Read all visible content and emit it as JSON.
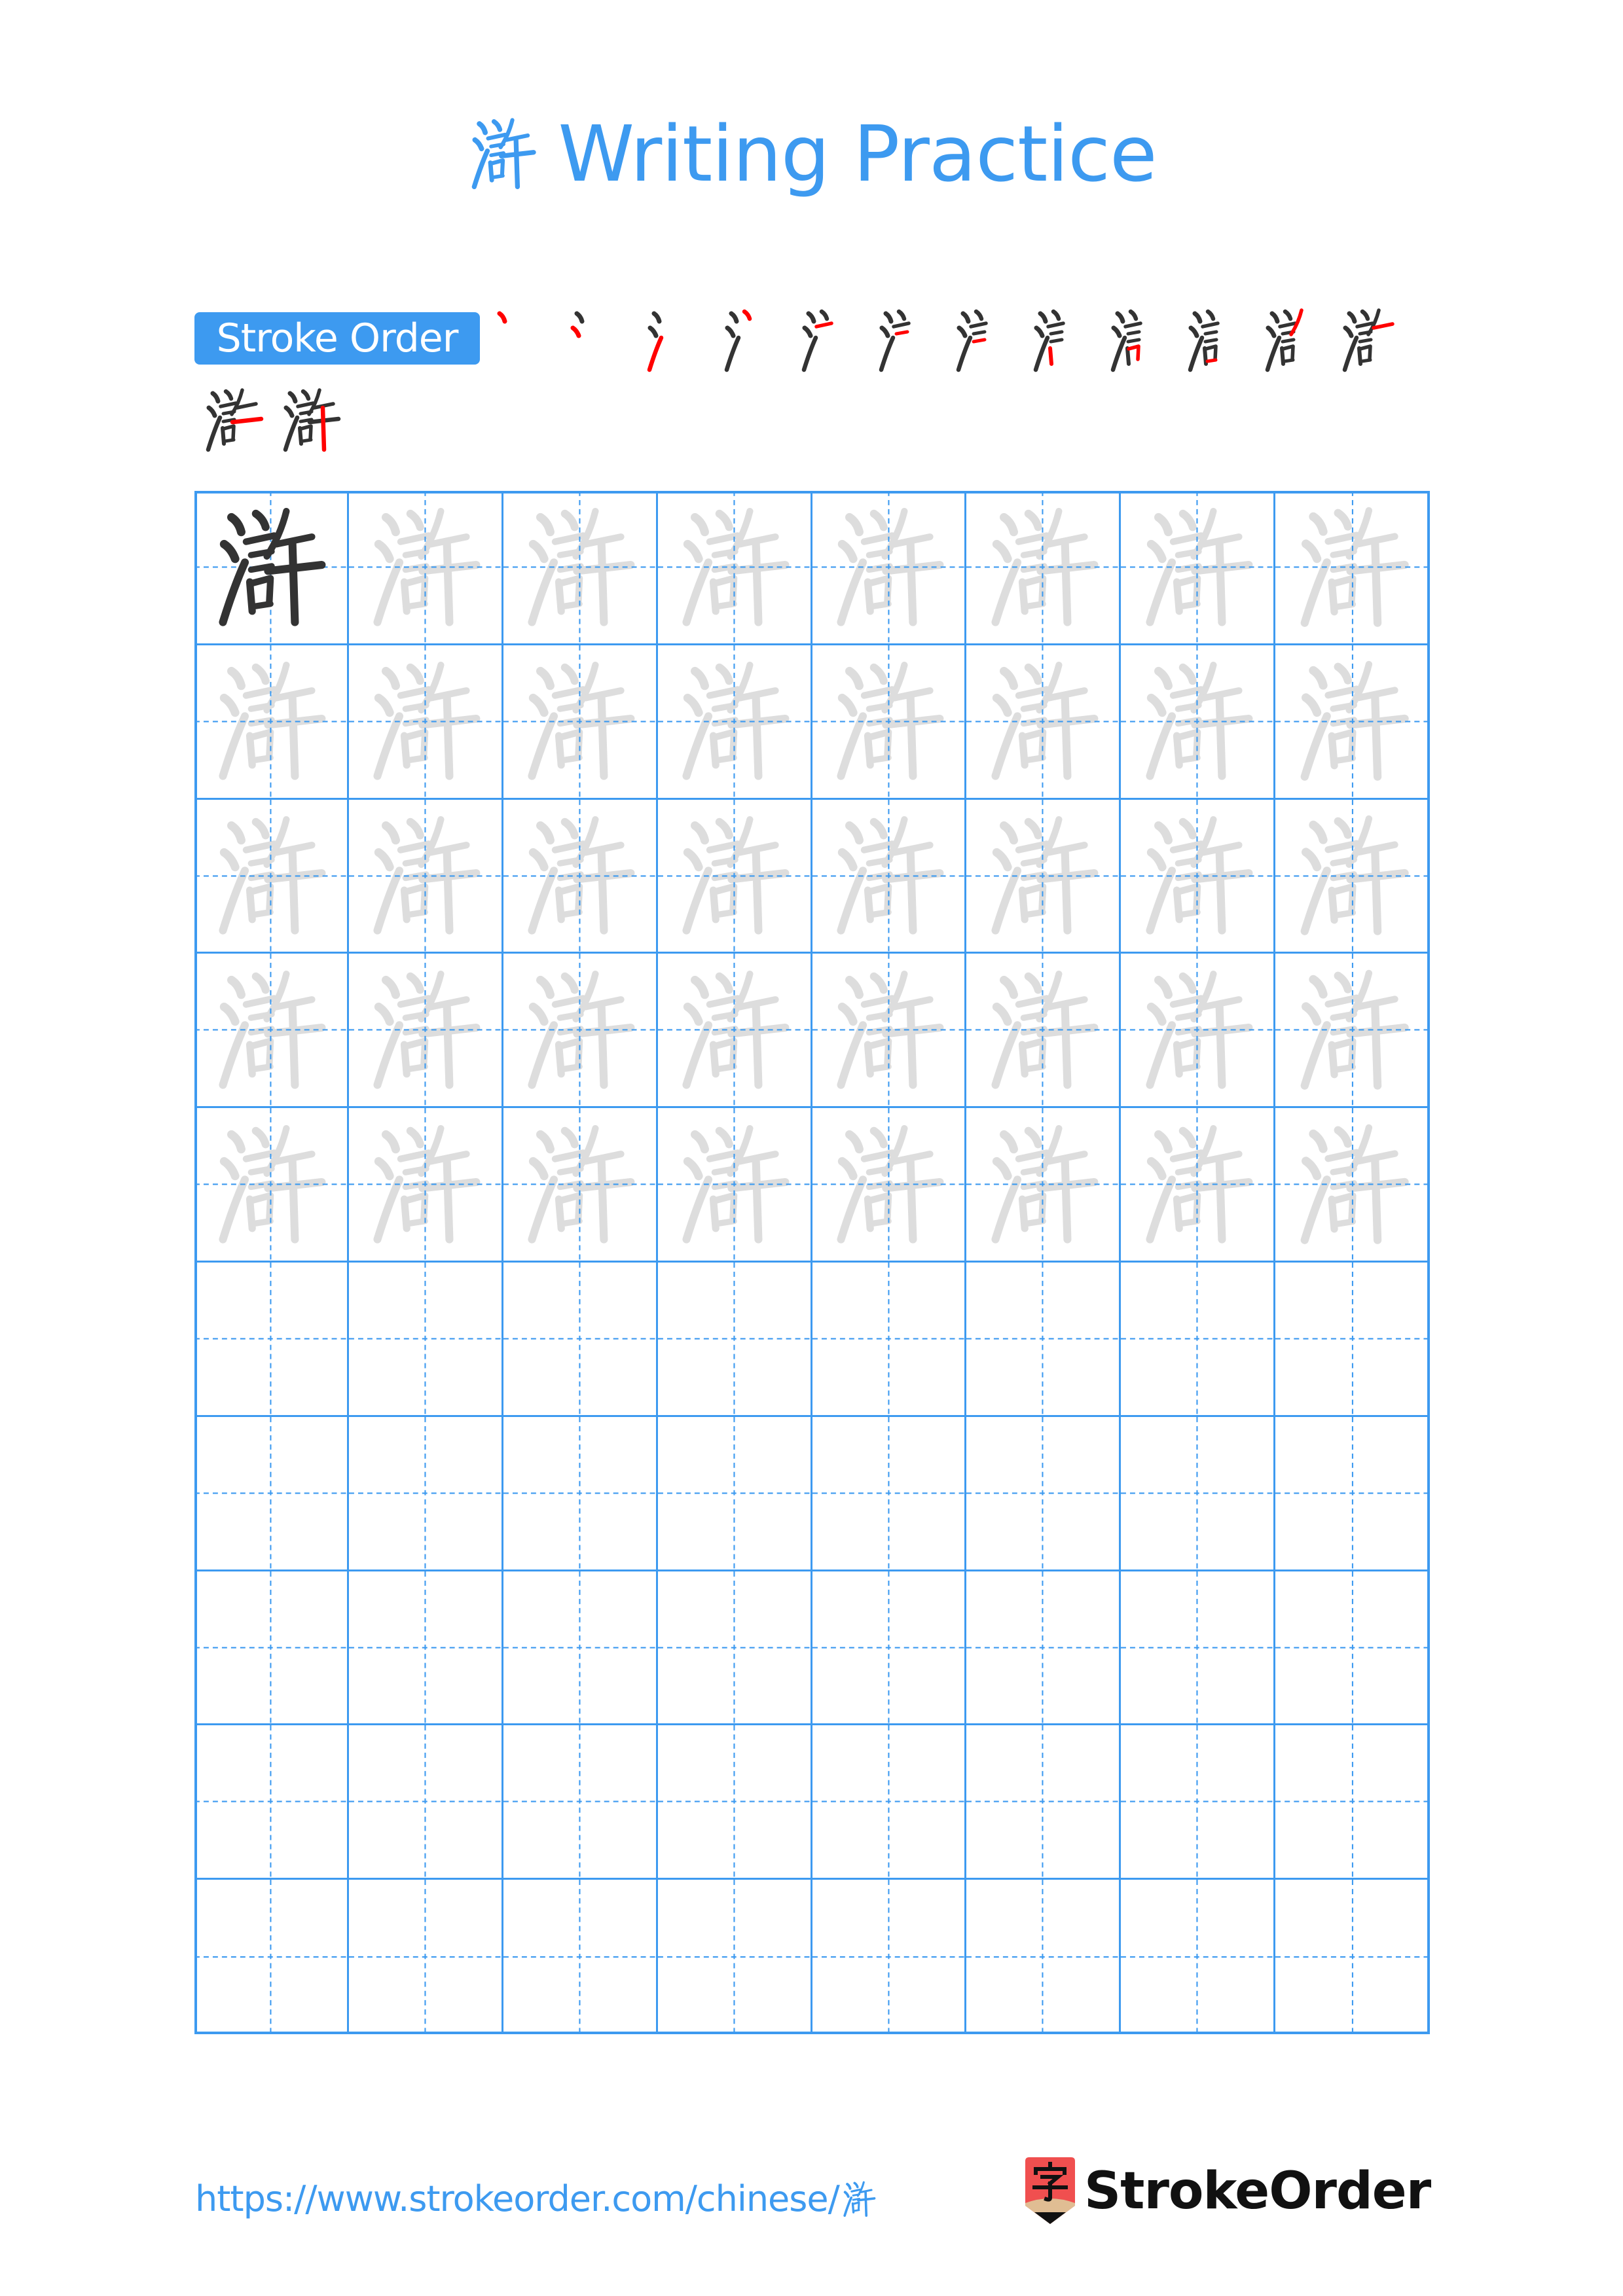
{
  "page": {
    "character": "滸",
    "title_suffix": "Writing Practice",
    "accent_color": "#3d9af0",
    "highlight_color": "#ff0000",
    "ink_color": "#333333",
    "trace_color": "#dddddd"
  },
  "stroke_order": {
    "label": "Stroke Order",
    "total_strokes": 14,
    "frames": [
      1,
      2,
      3,
      4,
      5,
      6,
      7,
      8,
      9,
      10,
      11,
      12,
      13,
      14
    ]
  },
  "practice_grid": {
    "columns": 8,
    "rows": 10,
    "model_cells": 1,
    "trace_rows": 5,
    "blank_rows": 5
  },
  "footer": {
    "url_prefix": "https://www.strokeorder.com/chinese/",
    "url_character": "滸",
    "logo_text": "StrokeOrder",
    "logo_icon_char": "字"
  }
}
